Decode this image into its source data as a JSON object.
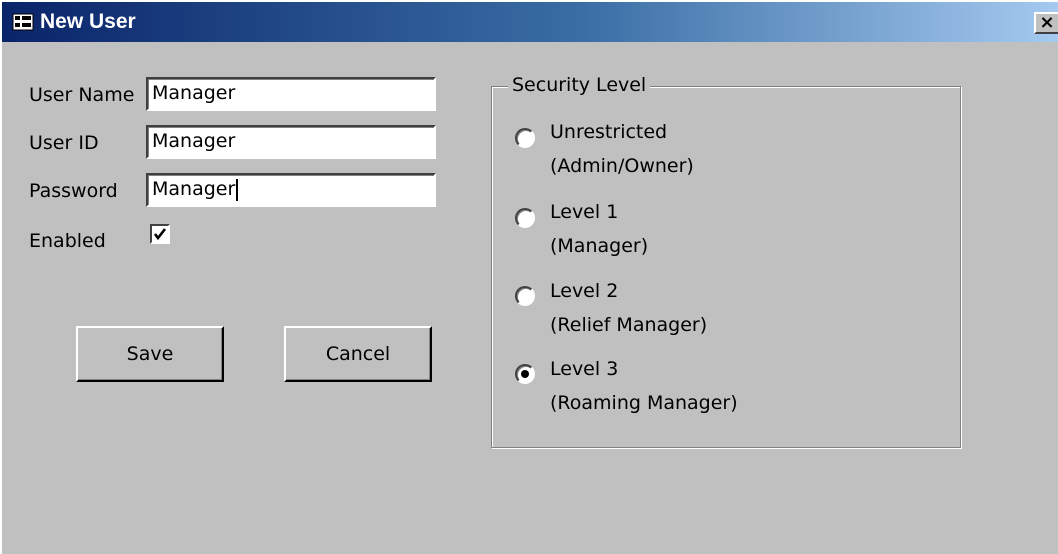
{
  "window": {
    "title": "New User",
    "icon": "form-icon",
    "close_label": "×"
  },
  "fields": {
    "user_name": {
      "label": "User Name",
      "value": "Manager"
    },
    "user_id": {
      "label": "User ID",
      "value": "Manager"
    },
    "password": {
      "label": "Password",
      "value": "Manager"
    },
    "enabled": {
      "label": "Enabled",
      "checked": true
    }
  },
  "buttons": {
    "save": "Save",
    "cancel": "Cancel"
  },
  "security": {
    "title": "Security Level",
    "options": [
      {
        "line1": "Unrestricted",
        "line2": "(Admin/Owner)",
        "checked": false
      },
      {
        "line1": "Level 1",
        "line2": "(Manager)",
        "checked": false
      },
      {
        "line1": "Level 2",
        "line2": "(Relief Manager)",
        "checked": false
      },
      {
        "line1": "Level 3",
        "line2": "(Roaming Manager)",
        "checked": true
      }
    ]
  },
  "colors": {
    "titlebar_start": "#0a246a",
    "titlebar_end": "#a6caf0",
    "face": "#c0c0c0"
  }
}
